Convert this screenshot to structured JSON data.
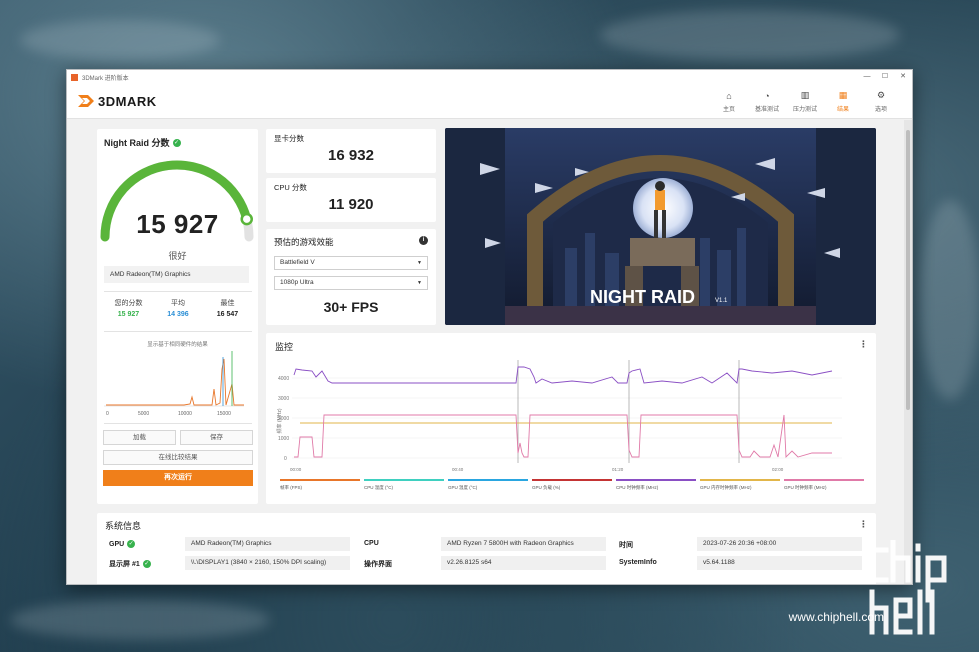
{
  "window": {
    "title": "3DMark 进阶版本",
    "controls": [
      "—",
      "☐",
      "✕"
    ]
  },
  "logo": {
    "text": "3DMARK"
  },
  "nav": [
    {
      "label": "主页",
      "icon": "home-icon",
      "glyph": "⌂"
    },
    {
      "label": "基准测试",
      "icon": "gauge-icon",
      "glyph": "◔"
    },
    {
      "label": "压力测试",
      "icon": "bar-chart-icon",
      "glyph": "▥"
    },
    {
      "label": "结果",
      "icon": "results-icon",
      "glyph": "▦",
      "active": true
    },
    {
      "label": "选项",
      "icon": "gear-icon",
      "glyph": "⚙"
    }
  ],
  "score": {
    "title": "Night Raid 分数",
    "value": "15 927",
    "rating": "很好",
    "gpu": "AMD Radeon(TM) Graphics",
    "gauge_fraction": 0.92,
    "stats": [
      {
        "label": "您的分数",
        "value": "15 927",
        "color": "#37b24d"
      },
      {
        "label": "平均",
        "value": "14 396",
        "color": "#2b8fd6"
      },
      {
        "label": "最佳",
        "value": "16 547",
        "color": "#222222"
      }
    ],
    "hist_caption": "显示基于相同硬件的结果",
    "hist_ticks": [
      "0",
      "5000",
      "10000",
      "15000"
    ],
    "buttons": {
      "load": "加载",
      "save": "保存",
      "compare": "在线比较结果",
      "run": "再次运行"
    }
  },
  "graphics_score": {
    "label": "显卡分数",
    "value": "16 932"
  },
  "cpu_score": {
    "label": "CPU 分数",
    "value": "11 920"
  },
  "fps_estimate": {
    "title": "预估的游戏效能",
    "game": "Battlefield V",
    "preset": "1080p Ultra",
    "fps": "30+ FPS"
  },
  "hero": {
    "title": "NIGHT RAID",
    "version": "V1.1"
  },
  "monitor": {
    "title": "监控",
    "y_label": "频率 (MHz)",
    "y_ticks": [
      "0",
      "1000",
      "2000",
      "3000",
      "4000"
    ],
    "x_ticks": [
      "00:00",
      "00:40",
      "01:20",
      "02:00"
    ],
    "legend": [
      {
        "label": "帧率 (FPS)",
        "color": "#e8762a"
      },
      {
        "label": "CPU 温度 (°C)",
        "color": "#3fd0c0"
      },
      {
        "label": "GPU 温度 (°C)",
        "color": "#2aa6e0"
      },
      {
        "label": "GPU 负载 (%)",
        "color": "#c43434"
      },
      {
        "label": "CPU 时钟频率 (MHz)",
        "color": "#8a4fc4"
      },
      {
        "label": "GPU 内存时钟频率 (MHz)",
        "color": "#e2b64a"
      },
      {
        "label": "GPU 时钟频率 (MHz)",
        "color": "#e07aa8"
      }
    ]
  },
  "system_info": {
    "title": "系统信息",
    "rows": [
      {
        "label": "GPU",
        "value": "AMD Radeon(TM) Graphics",
        "check": true
      },
      {
        "label": "显示屏 #1",
        "value": "\\\\.\\DISPLAY1 (3840 × 2160, 150% DPI scaling)",
        "check": true
      },
      {
        "label": "CPU",
        "value": "AMD Ryzen 7 5800H with Radeon Graphics"
      },
      {
        "label": "操作界面",
        "value": "v2.26.8125 s64"
      },
      {
        "label": "时间",
        "value": "2023-07-26 20:36 +08:00"
      },
      {
        "label": "SystemInfo",
        "value": "v5.64.1188"
      }
    ]
  },
  "watermark": {
    "url": "www.chiphell.com"
  }
}
